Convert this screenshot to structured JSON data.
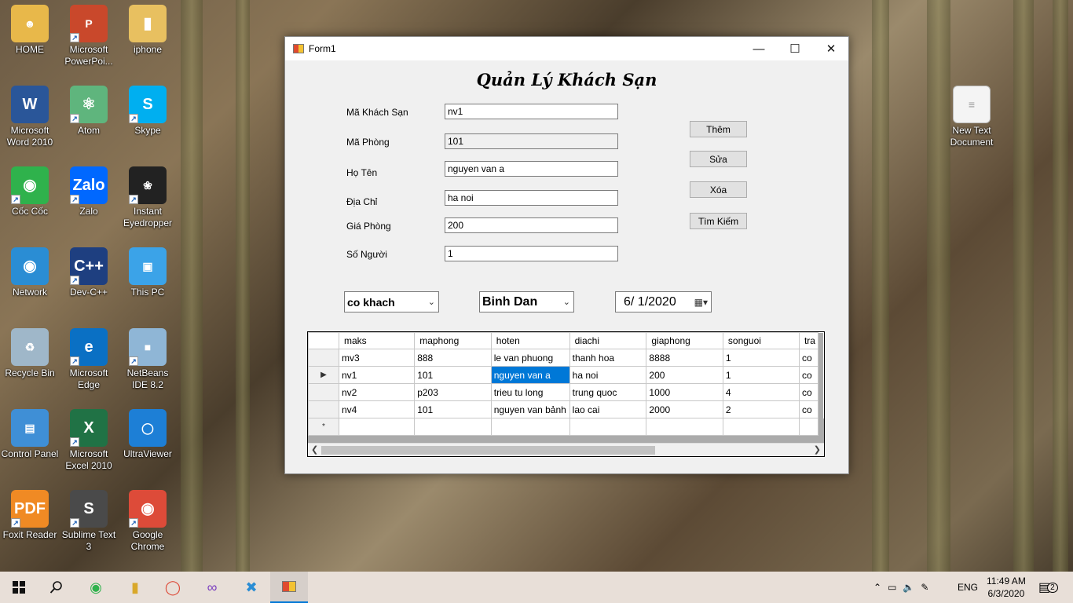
{
  "desktop": {
    "icons": [
      {
        "label": "HOME",
        "icon": "user-folder-icon",
        "color": "#e8b84a"
      },
      {
        "label": "Microsoft PowerPoi...",
        "icon": "powerpoint-icon",
        "color": "#c9482b"
      },
      {
        "label": "iphone",
        "icon": "folder-icon",
        "color": "#e8c060"
      },
      {
        "label": "Microsoft Word 2010",
        "icon": "word-icon",
        "color": "#2a5699"
      },
      {
        "label": "Atom",
        "icon": "atom-icon",
        "color": "#5fb57d"
      },
      {
        "label": "Skype",
        "icon": "skype-icon",
        "color": "#00aff0"
      },
      {
        "label": "Cốc Cốc",
        "icon": "coccoc-icon",
        "color": "#2fb24c"
      },
      {
        "label": "Zalo",
        "icon": "zalo-icon",
        "color": "#0068ff"
      },
      {
        "label": "Instant Eyedropper",
        "icon": "eyedropper-icon",
        "color": "#222222"
      },
      {
        "label": "Network",
        "icon": "network-icon",
        "color": "#2a8dd4"
      },
      {
        "label": "Dev-C++",
        "icon": "devcpp-icon",
        "color": "#1e3f80"
      },
      {
        "label": "This PC",
        "icon": "computer-icon",
        "color": "#3ba3e8"
      },
      {
        "label": "Recycle Bin",
        "icon": "recycle-bin-icon",
        "color": "#9fb7c9"
      },
      {
        "label": "Microsoft Edge",
        "icon": "edge-icon",
        "color": "#0a70c4"
      },
      {
        "label": "NetBeans IDE 8.2",
        "icon": "netbeans-icon",
        "color": "#8fb6d6"
      },
      {
        "label": "Control Panel",
        "icon": "control-panel-icon",
        "color": "#3f8fd6"
      },
      {
        "label": "Microsoft Excel 2010",
        "icon": "excel-icon",
        "color": "#207245"
      },
      {
        "label": "UltraViewer",
        "icon": "ultraviewer-icon",
        "color": "#1d7fd6"
      },
      {
        "label": "Foxit Reader",
        "icon": "foxit-icon",
        "color": "#f08a24"
      },
      {
        "label": "Sublime Text 3",
        "icon": "sublime-icon",
        "color": "#4a4a4a"
      },
      {
        "label": "Google Chrome",
        "icon": "chrome-icon",
        "color": "#dd4b39"
      },
      {
        "label": "New Text Document",
        "icon": "text-file-icon",
        "color": "#f4f4f4"
      }
    ]
  },
  "window": {
    "title": "Form1",
    "heading": "Quản Lý Khách Sạn",
    "fields": [
      {
        "label": "Mã Khách Sạn",
        "value": "nv1"
      },
      {
        "label": "Mã Phòng",
        "value": "101"
      },
      {
        "label": "Họ Tên",
        "value": "nguyen van a"
      },
      {
        "label": "Địa Chỉ",
        "value": "ha noi"
      },
      {
        "label": "Giá Phòng",
        "value": "200"
      },
      {
        "label": "Số Người",
        "value": "1"
      }
    ],
    "buttons": {
      "add": "Thêm",
      "edit": "Sửa",
      "delete": "Xóa",
      "search": "Tìm Kiếm"
    },
    "status_combo": "co khach",
    "type_combo": "Binh Dan",
    "date": "6/  1/2020",
    "grid": {
      "columns": [
        "maks",
        "maphong",
        "hoten",
        "diachi",
        "giaphong",
        "songuoi",
        "tra"
      ],
      "rows": [
        [
          "mv3",
          "888",
          "le van phuong",
          "thanh hoa",
          "8888",
          "1",
          "co"
        ],
        [
          "nv1",
          "101",
          "nguyen van a",
          "ha noi",
          "200",
          "1",
          "co"
        ],
        [
          "nv2",
          "p203",
          "trieu tu long",
          "trung quoc",
          "1000",
          "4",
          "co"
        ],
        [
          "nv4",
          "101",
          "nguyen van bảnh",
          "lao cai",
          "2000",
          "2",
          "co"
        ]
      ],
      "current_row_marker": "▶",
      "new_row_marker": "*"
    }
  },
  "taskbar": {
    "language": "ENG",
    "time": "11:49 AM",
    "date": "6/3/2020",
    "notifications": "2"
  }
}
